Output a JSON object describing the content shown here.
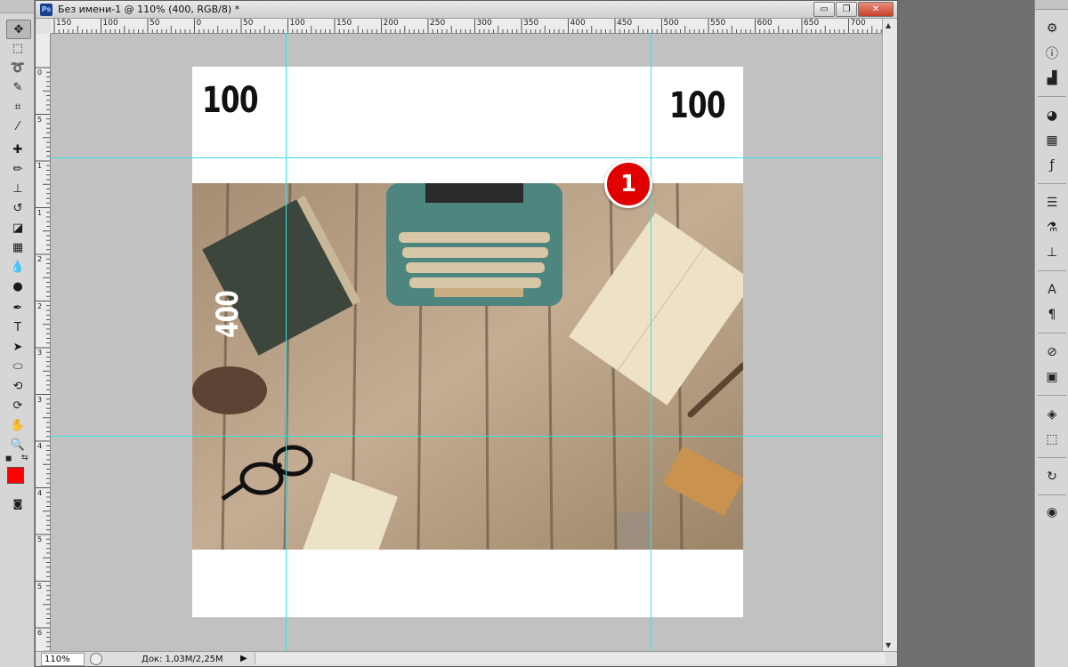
{
  "document": {
    "title": "Без имени-1 @ 110% (400, RGB/8) *",
    "app_icon_label": "Ps",
    "zoom": "110%",
    "doc_info": "Док: 1,03M/2,25M"
  },
  "ruler": {
    "h_labels": [
      "150",
      "100",
      "50",
      "0",
      "50",
      "100",
      "150",
      "200",
      "250",
      "300",
      "350",
      "400",
      "450",
      "500",
      "550",
      "600",
      "650",
      "700"
    ],
    "v_labels": [
      "0",
      "5",
      "1",
      "1",
      "2",
      "2",
      "3",
      "3",
      "4",
      "4",
      "5",
      "5",
      "6"
    ]
  },
  "canvas": {
    "label_top_left": "100",
    "label_top_right": "100",
    "label_rotated": "400",
    "badge": "1"
  },
  "toolbar": {
    "tools": [
      "move-icon",
      "marquee-icon",
      "lasso-icon",
      "quick-select-icon",
      "crop-icon",
      "eyedropper-icon",
      "healing-icon",
      "brush-icon",
      "stamp-icon",
      "history-brush-icon",
      "eraser-icon",
      "gradient-icon",
      "blur-icon",
      "dodge-icon",
      "pen-icon",
      "type-icon",
      "path-select-icon",
      "ellipse-icon",
      "3d-rotate-icon",
      "3d-orbit-icon",
      "hand-icon",
      "zoom-icon"
    ],
    "foreground_color": "#ff0000",
    "background_color": "#ffffff"
  },
  "window_controls": {
    "minimize": "▭",
    "restore": "❐",
    "close": "✕"
  },
  "dock": {
    "buttons": [
      "navigator-icon",
      "info-icon",
      "histogram-icon",
      "color-icon",
      "swatches-icon",
      "styles-icon",
      "adjustments-icon",
      "masks-icon",
      "clone-source-icon",
      "character-icon",
      "paragraph-icon",
      "brush-presets-icon",
      "tool-presets-icon",
      "layers-icon",
      "paths-icon",
      "history-icon",
      "3d-icon"
    ]
  },
  "colors": {
    "guide": "#39e0e8",
    "badge": "#e00000"
  }
}
